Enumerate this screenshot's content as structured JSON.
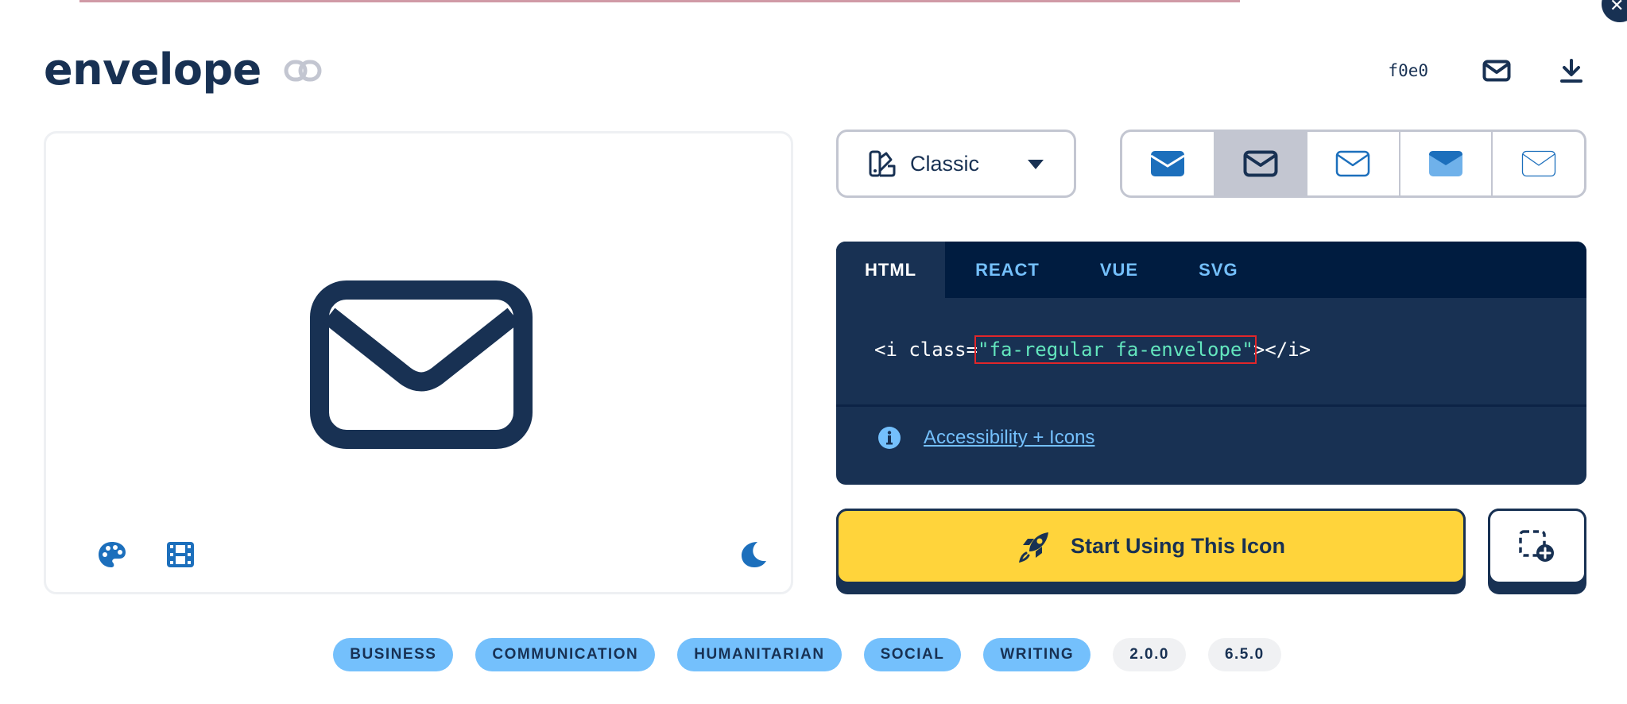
{
  "icon": {
    "name": "envelope",
    "unicode": "f0e0"
  },
  "family_select": {
    "selected": "Classic"
  },
  "styles": [
    {
      "name": "solid",
      "selected": false
    },
    {
      "name": "regular",
      "selected": true
    },
    {
      "name": "light",
      "selected": false
    },
    {
      "name": "duotone",
      "selected": false
    },
    {
      "name": "thin",
      "selected": false
    }
  ],
  "code": {
    "tabs": [
      "HTML",
      "REACT",
      "VUE",
      "SVG"
    ],
    "active_tab": "HTML",
    "prefix": "<i class=",
    "class_string": "\"fa-regular fa-envelope\"",
    "suffix": "></i>",
    "accessibility_link": "Accessibility + Icons"
  },
  "actions": {
    "start_label": "Start Using This Icon"
  },
  "tags": [
    "BUSINESS",
    "COMMUNICATION",
    "HUMANITARIAN",
    "SOCIAL",
    "WRITING"
  ],
  "versions": [
    "2.0.0",
    "6.5.0"
  ],
  "colors": {
    "navy": "#183153",
    "accent_blue": "#1c6fbc",
    "light_blue": "#74c0fc",
    "yellow": "#ffd43b",
    "code_green": "#63e6be",
    "highlight_red": "#e0262a"
  }
}
